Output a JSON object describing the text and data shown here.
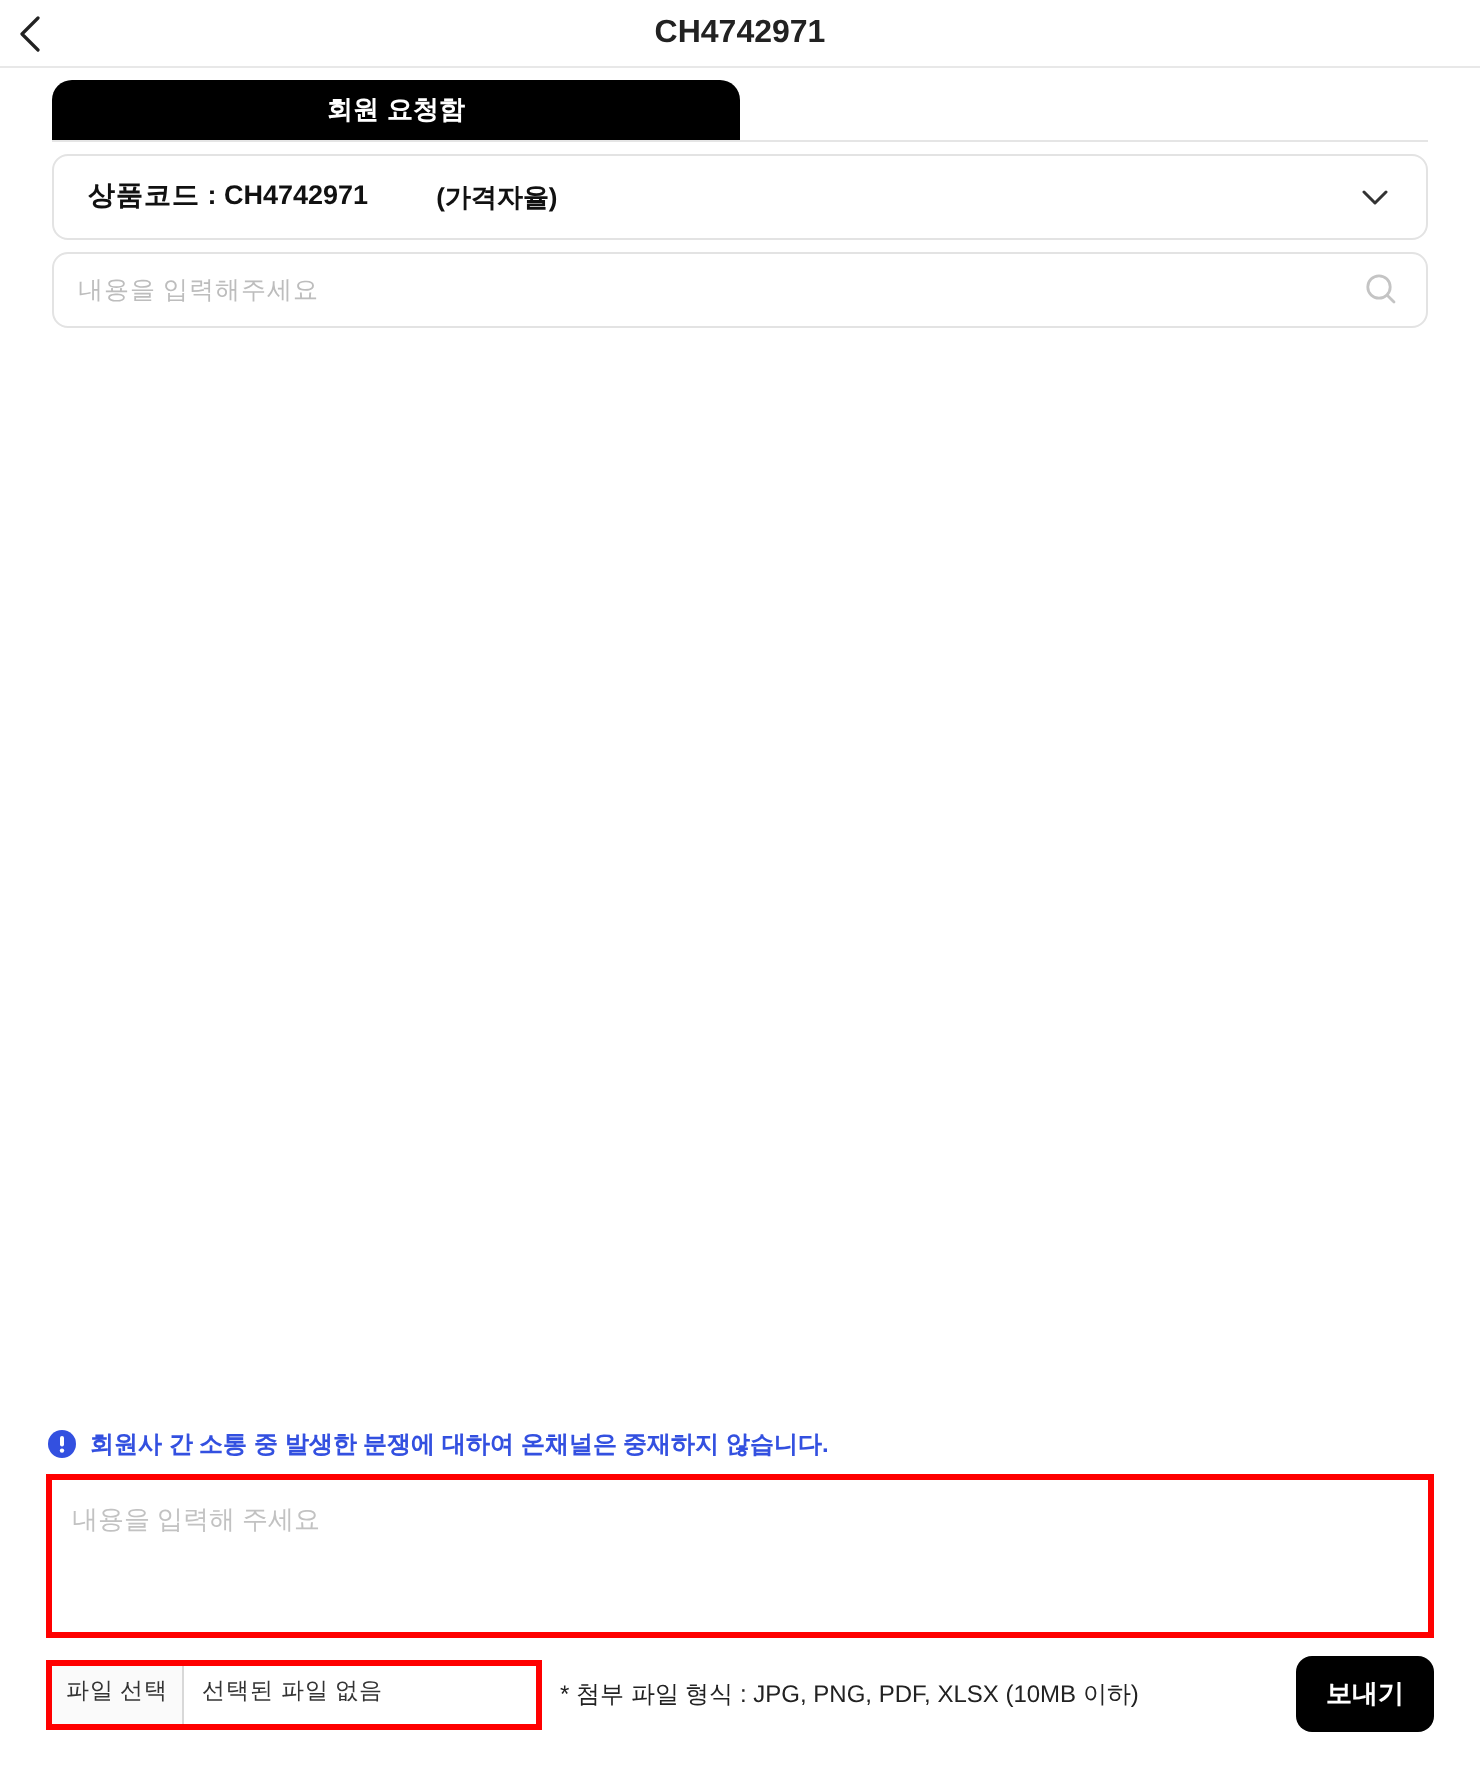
{
  "header": {
    "title": "CH4742971"
  },
  "tabs": [
    {
      "label": "회원 요청함",
      "selected": true
    }
  ],
  "product_select": {
    "code_label": "상품코드 : CH4742971",
    "price_note": "(가격자율)"
  },
  "search": {
    "placeholder": "내용을 입력해주세요"
  },
  "notice": {
    "text": "회원사 간 소통 중 발생한 분쟁에 대하여 온채널은 중재하지 않습니다."
  },
  "message": {
    "placeholder": "내용을 입력해 주세요",
    "highlighted": true
  },
  "file_input": {
    "button": "파일 선택",
    "status": "선택된 파일 없음",
    "highlighted": true
  },
  "file_hint": "* 첨부 파일 형식 : JPG, PNG, PDF, XLSX (10MB 이하)",
  "send_button": "보내기"
}
